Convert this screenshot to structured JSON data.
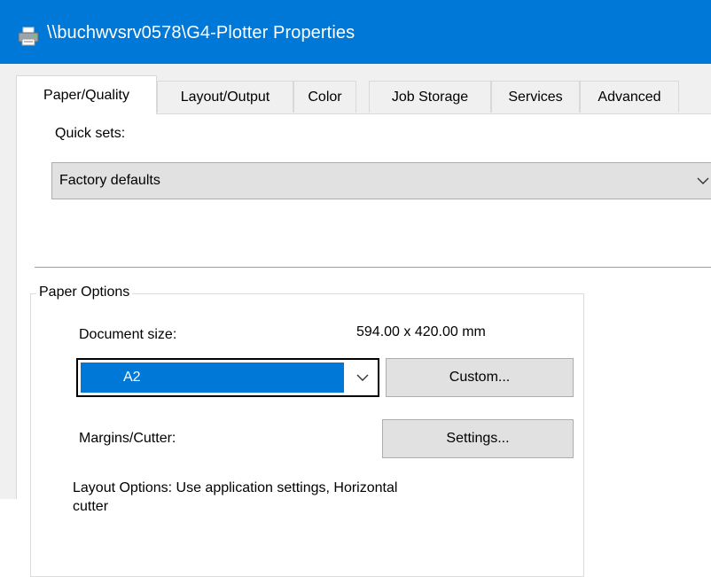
{
  "window": {
    "title": "\\\\buchwvsrv0578\\G4-Plotter Properties",
    "icon": "printer-icon",
    "accent": "#0078d7"
  },
  "tabs": [
    {
      "label": "Paper/Quality",
      "active": true
    },
    {
      "label": "Layout/Output",
      "active": false
    },
    {
      "label": "Color",
      "active": false
    },
    {
      "label": "Job Storage",
      "active": false
    },
    {
      "label": "Services",
      "active": false
    },
    {
      "label": "Advanced",
      "active": false
    }
  ],
  "quick_sets": {
    "label": "Quick sets:",
    "value": "Factory defaults"
  },
  "paper_options": {
    "legend": "Paper Options",
    "document_size_label": "Document size:",
    "document_size_value": "594.00 x 420.00 mm",
    "size_selected": "A2",
    "custom_button": "Custom...",
    "margins_label": "Margins/Cutter:",
    "settings_button": "Settings...",
    "layout_options_text": "Layout Options: Use application settings, Horizontal\ncutter"
  }
}
